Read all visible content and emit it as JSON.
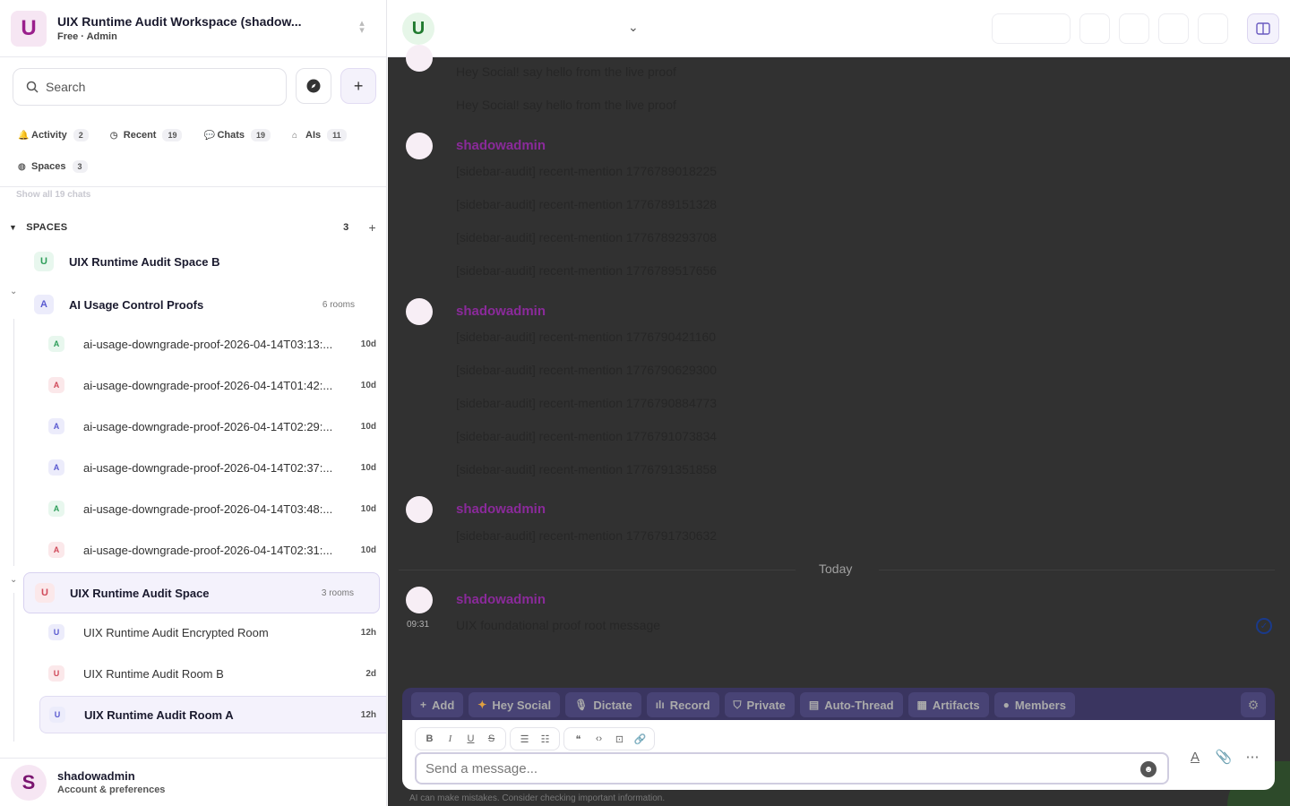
{
  "workspace": {
    "avatar": "U",
    "title": "UIX Runtime Audit Workspace (shadow...",
    "subtitle": "Free · Admin"
  },
  "search": {
    "placeholder": "Search"
  },
  "filters": [
    {
      "label": "Activity",
      "count": "2",
      "icon": "bell-icon"
    },
    {
      "label": "Recent",
      "count": "19",
      "icon": "clock-icon"
    },
    {
      "label": "Chats",
      "count": "19",
      "icon": "chat-icon"
    },
    {
      "label": "AIs",
      "count": "11",
      "icon": "robot-icon"
    },
    {
      "label": "Spaces",
      "count": "3",
      "icon": "globe-icon"
    }
  ],
  "faded_link": "Show all 19 chats",
  "spaces_section": {
    "label": "SPACES",
    "count": "3"
  },
  "spaces": [
    {
      "avatar": "U",
      "name": "UIX Runtime Audit Space B",
      "meta": "",
      "color": "#2e9e5a",
      "bg": "#e8f7ee"
    },
    {
      "avatar": "A",
      "name": "AI Usage Control Proofs",
      "meta": "6 rooms",
      "color": "#5a5ad0",
      "bg": "#ececfb"
    },
    {
      "avatar": "U",
      "name": "UIX Runtime Audit Space",
      "meta": "3 rooms",
      "color": "#d04a5a",
      "bg": "#fbe8ea"
    }
  ],
  "rooms_ai": [
    {
      "avatar": "A",
      "name": "ai-usage-downgrade-proof-2026-04-14T03:13:...",
      "time": "10d",
      "color": "#2e9e5a",
      "bg": "#e8f7ee"
    },
    {
      "avatar": "A",
      "name": "ai-usage-downgrade-proof-2026-04-14T01:42:...",
      "time": "10d",
      "color": "#d04a5a",
      "bg": "#fbe8ea"
    },
    {
      "avatar": "A",
      "name": "ai-usage-downgrade-proof-2026-04-14T02:29:...",
      "time": "10d",
      "color": "#5a5ad0",
      "bg": "#ececfb"
    },
    {
      "avatar": "A",
      "name": "ai-usage-downgrade-proof-2026-04-14T02:37:...",
      "time": "10d",
      "color": "#5a5ad0",
      "bg": "#ececfb"
    },
    {
      "avatar": "A",
      "name": "ai-usage-downgrade-proof-2026-04-14T03:48:...",
      "time": "10d",
      "color": "#2e9e5a",
      "bg": "#e8f7ee"
    },
    {
      "avatar": "A",
      "name": "ai-usage-downgrade-proof-2026-04-14T02:31:...",
      "time": "10d",
      "color": "#d04a5a",
      "bg": "#fbe8ea"
    }
  ],
  "rooms_uix": [
    {
      "avatar": "U",
      "name": "UIX Runtime Audit Encrypted Room",
      "time": "12h",
      "color": "#5a5ad0",
      "bg": "#ececfb"
    },
    {
      "avatar": "U",
      "name": "UIX Runtime Audit Room B",
      "time": "2d",
      "color": "#d04a5a",
      "bg": "#fbe8ea"
    },
    {
      "avatar": "U",
      "name": "UIX Runtime Audit Room A",
      "time": "12h",
      "color": "#5a5ad0",
      "bg": "#ececfb"
    }
  ],
  "account": {
    "avatar": "S",
    "name": "shadowadmin",
    "subtitle": "Account & preferences"
  },
  "room_header": {
    "avatar": "U"
  },
  "messages": {
    "orphan_lines": [
      "Hey Social! say hello from the live proof",
      "Hey Social! say hello from the live proof"
    ],
    "groups": [
      {
        "sender": "shadowadmin",
        "lines": [
          "[sidebar-audit] recent-mention 1776789018225",
          "[sidebar-audit] recent-mention 1776789151328",
          "[sidebar-audit] recent-mention 1776789293708",
          "[sidebar-audit] recent-mention 1776789517656"
        ]
      },
      {
        "sender": "shadowadmin",
        "lines": [
          "[sidebar-audit] recent-mention 1776790421160",
          "[sidebar-audit] recent-mention 1776790629300",
          "[sidebar-audit] recent-mention 1776790884773",
          "[sidebar-audit] recent-mention 1776791073834",
          "[sidebar-audit] recent-mention 1776791351858"
        ]
      },
      {
        "sender": "shadowadmin",
        "lines": [
          "[sidebar-audit] recent-mention 1776791730632"
        ]
      }
    ],
    "day_divider": "Today",
    "today": {
      "sender": "shadowadmin",
      "time": "09:31",
      "text": "UIX foundational proof root message"
    }
  },
  "composer_tools": [
    {
      "label": "Add",
      "icon": "plus-icon"
    },
    {
      "label": "Hey Social",
      "icon": "sparkle-icon"
    },
    {
      "label": "Dictate",
      "icon": "mic-icon"
    },
    {
      "label": "Record",
      "icon": "waveform-icon"
    },
    {
      "label": "Private",
      "icon": "shield-icon"
    },
    {
      "label": "Auto-Thread",
      "icon": "thread-icon"
    },
    {
      "label": "Artifacts",
      "icon": "document-icon"
    },
    {
      "label": "Members",
      "icon": "user-icon"
    }
  ],
  "composer": {
    "placeholder": "Send a message..."
  },
  "disclaimer": {
    "main": "AI can make mistakes.",
    "hint": "Consider checking important information."
  }
}
